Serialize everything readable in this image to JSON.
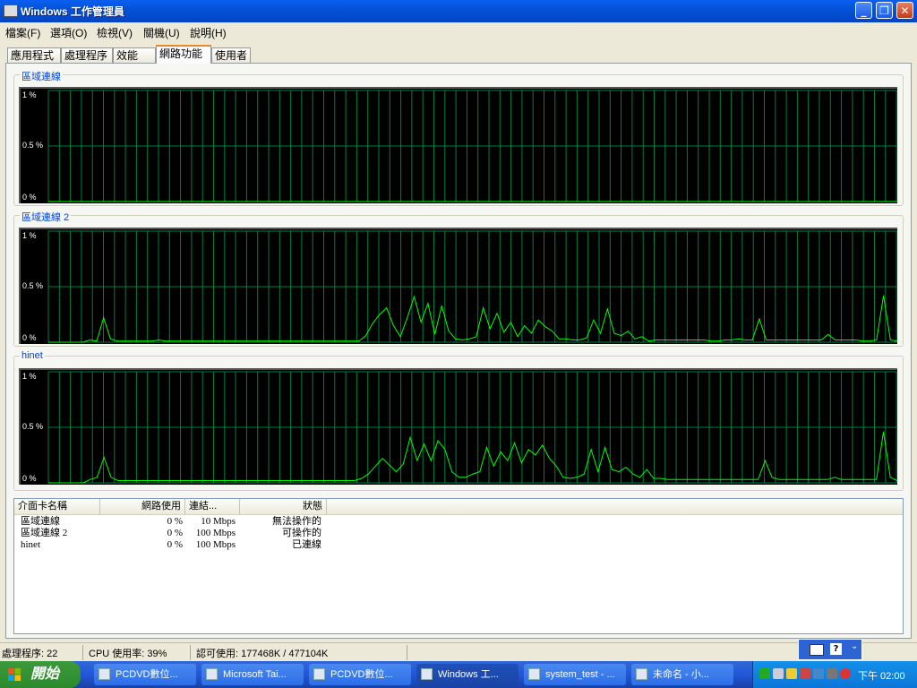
{
  "window": {
    "title": "Windows 工作管理員"
  },
  "menu": [
    "檔案(F)",
    "選項(O)",
    "檢視(V)",
    "關機(U)",
    "說明(H)"
  ],
  "tabs": [
    {
      "label": "應用程式",
      "active": false
    },
    {
      "label": "處理程序",
      "active": false
    },
    {
      "label": "效能",
      "active": false
    },
    {
      "label": "網路功能",
      "active": true
    },
    {
      "label": "使用者",
      "active": false
    }
  ],
  "graphs": [
    {
      "label": "區域連線",
      "y_ticks": [
        "1 %",
        "0.5 %",
        "0 %"
      ],
      "line_color": "#00ff00"
    },
    {
      "label": "區域連線 2",
      "y_ticks": [
        "1 %",
        "0.5 %",
        "0 %"
      ],
      "line_color": "#00ff00"
    },
    {
      "label": "hinet",
      "y_ticks": [
        "1 %",
        "0.5 %",
        "0 %"
      ],
      "line_color": "#00ff00"
    }
  ],
  "chart_data": [
    {
      "type": "line",
      "title": "區域連線",
      "ylim": [
        0,
        1
      ],
      "grid": true,
      "series": [
        {
          "values": [
            0,
            0,
            0,
            0,
            0,
            0,
            0,
            0,
            0,
            0,
            0,
            0,
            0,
            0,
            0,
            0,
            0,
            0,
            0,
            0,
            0,
            0,
            0,
            0,
            0,
            0,
            0,
            0,
            0,
            0,
            0,
            0,
            0,
            0,
            0,
            0,
            0,
            0,
            0,
            0,
            0,
            0,
            0,
            0,
            0,
            0,
            0,
            0,
            0,
            0,
            0,
            0,
            0,
            0,
            0,
            0,
            0,
            0,
            0,
            0,
            0,
            0,
            0,
            0,
            0,
            0,
            0,
            0,
            0,
            0,
            0,
            0,
            0,
            0,
            0,
            0,
            0,
            0,
            0,
            0,
            0,
            0,
            0,
            0,
            0,
            0,
            0,
            0,
            0,
            0,
            0,
            0,
            0,
            0,
            0,
            0,
            0,
            0,
            0,
            0
          ]
        }
      ]
    },
    {
      "type": "line",
      "title": "區域連線 2",
      "ylim": [
        0,
        1
      ],
      "grid": true,
      "series": [
        {
          "values": [
            0,
            0,
            0,
            0,
            0,
            0,
            0.02,
            0.01,
            0.22,
            0.03,
            0.01,
            0.01,
            0.01,
            0.01,
            0.01,
            0.01,
            0.02,
            0.01,
            0.01,
            0.01,
            0.01,
            0.01,
            0.01,
            0.01,
            0.01,
            0.01,
            0.01,
            0.01,
            0.01,
            0.01,
            0.01,
            0.01,
            0.01,
            0.01,
            0.01,
            0.01,
            0.01,
            0.01,
            0.01,
            0.01,
            0.01,
            0.01,
            0.01,
            0.01,
            0.01,
            0.01,
            0.06,
            0.17,
            0.25,
            0.31,
            0.15,
            0.05,
            0.22,
            0.41,
            0.18,
            0.35,
            0.07,
            0.33,
            0.1,
            0.03,
            0.02,
            0.03,
            0.05,
            0.31,
            0.12,
            0.26,
            0.09,
            0.18,
            0.05,
            0.15,
            0.08,
            0.2,
            0.14,
            0.1,
            0.03,
            0.03,
            0.02,
            0.02,
            0.04,
            0.2,
            0.08,
            0.3,
            0.08,
            0.06,
            0.1,
            0.03,
            0.05,
            0.01,
            0.02,
            0.02,
            0.02,
            0.02,
            0.02,
            0.02,
            0.02,
            0.02,
            0.01,
            0.01,
            0.02,
            0.02,
            0.03,
            0.02,
            0.02,
            0.21,
            0.02,
            0.02,
            0.02,
            0.02,
            0.02,
            0.02,
            0.02,
            0.02,
            0.02,
            0.07,
            0.02,
            0.02,
            0.02,
            0.02,
            0.01,
            0.01,
            0.02,
            0.42,
            0.02,
            0.01
          ]
        }
      ]
    },
    {
      "type": "line",
      "title": "hinet",
      "ylim": [
        0,
        1
      ],
      "grid": true,
      "series": [
        {
          "values": [
            0,
            0,
            0,
            0,
            0,
            0,
            0.03,
            0.05,
            0.23,
            0.05,
            0.02,
            0.02,
            0.02,
            0.02,
            0.02,
            0.02,
            0.02,
            0.02,
            0.02,
            0.02,
            0.02,
            0.02,
            0.02,
            0.02,
            0.02,
            0.02,
            0.02,
            0.02,
            0.02,
            0.02,
            0.02,
            0.02,
            0.02,
            0.02,
            0.02,
            0.02,
            0.02,
            0.02,
            0.02,
            0.02,
            0.02,
            0.02,
            0.02,
            0.02,
            0.02,
            0.04,
            0.08,
            0.15,
            0.22,
            0.16,
            0.1,
            0.17,
            0.41,
            0.2,
            0.35,
            0.2,
            0.38,
            0.3,
            0.1,
            0.05,
            0.05,
            0.08,
            0.1,
            0.32,
            0.15,
            0.28,
            0.2,
            0.36,
            0.18,
            0.3,
            0.25,
            0.34,
            0.22,
            0.15,
            0.05,
            0.04,
            0.05,
            0.08,
            0.3,
            0.1,
            0.32,
            0.12,
            0.1,
            0.14,
            0.08,
            0.05,
            0.12,
            0.04,
            0.04,
            0.03,
            0.03,
            0.03,
            0.03,
            0.03,
            0.03,
            0.03,
            0.03,
            0.03,
            0.03,
            0.03,
            0.03,
            0.03,
            0.03,
            0.2,
            0.05,
            0.03,
            0.03,
            0.03,
            0.03,
            0.03,
            0.03,
            0.03,
            0.03,
            0.05,
            0.03,
            0.03,
            0.03,
            0.03,
            0.03,
            0.03,
            0.46,
            0.05,
            0.02
          ]
        }
      ]
    }
  ],
  "list": {
    "headers": [
      "介面卡名稱",
      "網路使用",
      "連結...",
      "狀態"
    ],
    "rows": [
      {
        "name": "區域連線",
        "usage": "0 %",
        "speed": "10 Mbps",
        "status": "無法操作的"
      },
      {
        "name": "區域連線 2",
        "usage": "0 %",
        "speed": "100 Mbps",
        "status": "可操作的"
      },
      {
        "name": "hinet",
        "usage": "0 %",
        "speed": "100 Mbps",
        "status": "已連線"
      }
    ]
  },
  "status": {
    "processes": "處理程序: 22",
    "cpu": "CPU 使用率: 39%",
    "commit": "認可使用: 177468K / 477104K"
  },
  "taskbar": {
    "start": "開始",
    "tasks": [
      {
        "label": "PCDVD數位...",
        "active": false
      },
      {
        "label": "Microsoft Tai...",
        "active": false
      },
      {
        "label": "PCDVD數位...",
        "active": false
      },
      {
        "label": "Windows 工...",
        "active": true
      },
      {
        "label": "system_test - ...",
        "active": false
      },
      {
        "label": "未命名 - 小...",
        "active": false
      }
    ],
    "clock": "下午 02:00"
  },
  "colors": {
    "accent": "#0046d5",
    "graph_bg": "#000000",
    "grid": "#008040",
    "line": "#00ff00"
  }
}
